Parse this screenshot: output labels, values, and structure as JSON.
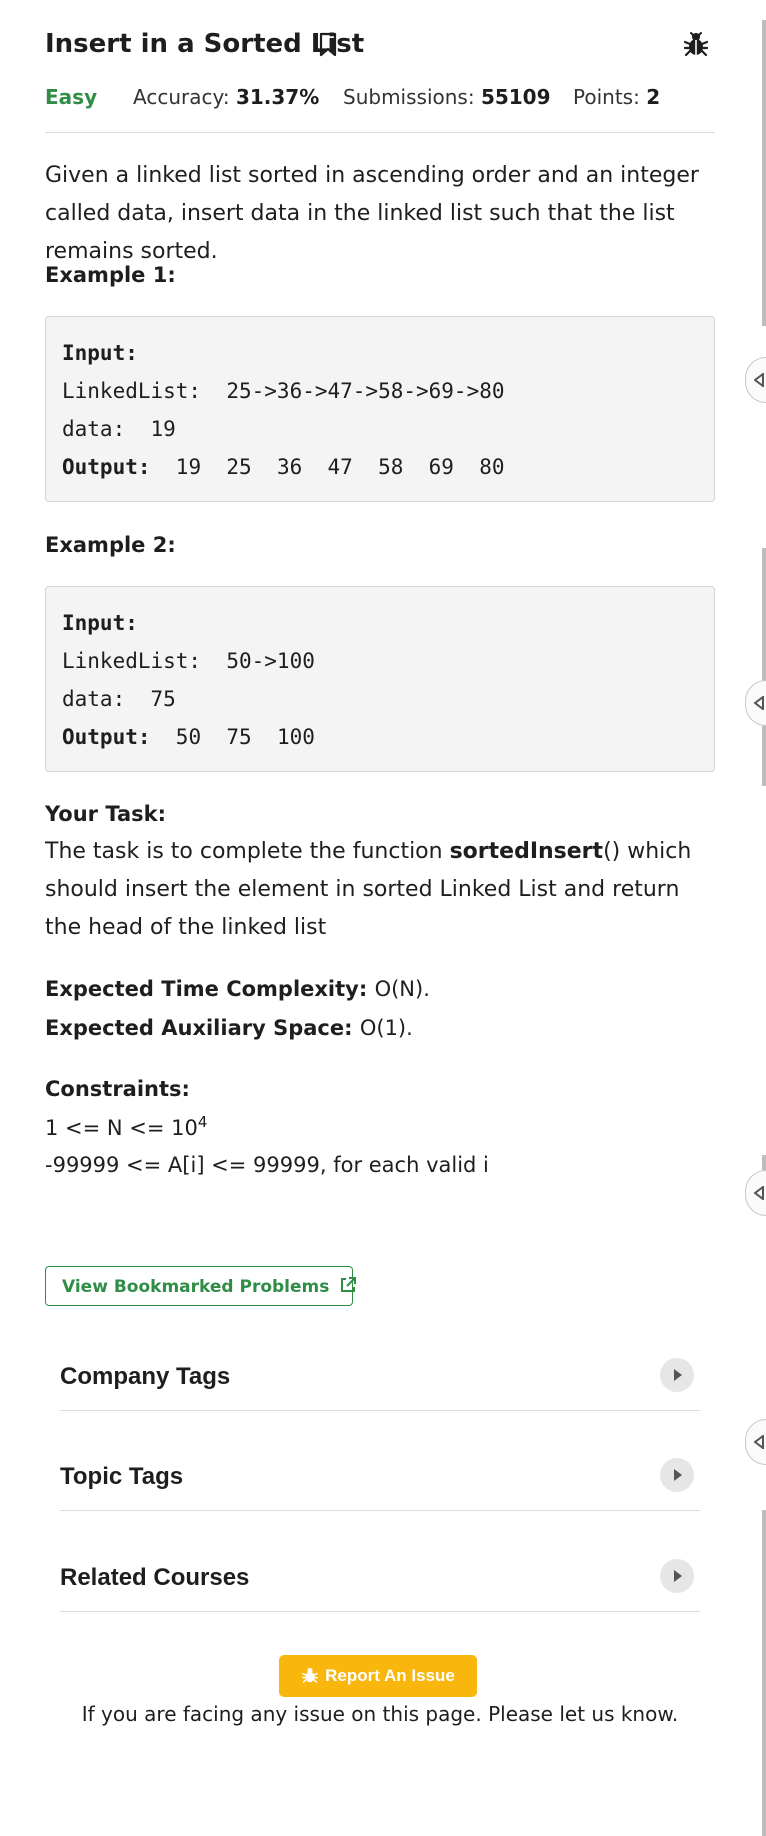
{
  "header": {
    "title": "Insert in a Sorted List",
    "difficulty": "Easy",
    "accuracy_label": "Accuracy: ",
    "accuracy_value": "31.37%",
    "submissions_label": "Submissions: ",
    "submissions_value": "55109",
    "points_label": "Points: ",
    "points_value": "2"
  },
  "description": "Given a linked list sorted in ascending order and an integer called data, insert data in the linked list such that the list remains sorted.",
  "examples": [
    {
      "heading": "Example 1:",
      "input_label": "Input:",
      "list_line": "LinkedList:  25->36->47->58->69->80",
      "data_line": "data:  19",
      "output_label": "Output:",
      "output_value": "  19  25  36  47  58  69  80"
    },
    {
      "heading": "Example 2:",
      "input_label": "Input:",
      "list_line": "LinkedList:  50->100",
      "data_line": "data:  75",
      "output_label": "Output:",
      "output_value": "  50  75  100"
    }
  ],
  "task": {
    "heading": "Your Task:",
    "text_before": "The task is to complete the function ",
    "function_name": "sortedInsert",
    "text_after": "() which should insert the element in sorted Linked List and return the head of the linked list"
  },
  "complexity": {
    "time_label": "Expected Time Complexity: ",
    "time_value": "O(N).",
    "space_label": "Expected Auxiliary Space: ",
    "space_value": "O(1)."
  },
  "constraints": {
    "heading": "Constraints:",
    "line1_prefix": "1 <= N <= 10",
    "line1_exp": "4",
    "line2": "-99999 <= A[i] <= 99999, for each valid i"
  },
  "view_bookmarked_label": "View Bookmarked Problems",
  "accordion": [
    {
      "label": "Company Tags"
    },
    {
      "label": "Topic Tags"
    },
    {
      "label": "Related Courses"
    }
  ],
  "report": {
    "button_label": "Report An Issue",
    "note": "If you are facing any issue on this page. Please let us know."
  },
  "colors": {
    "accent_green": "#2f8d46",
    "report_yellow": "#f9b70d",
    "example_bg": "#f4f4f4"
  },
  "icons": [
    "bookmark-icon",
    "bug-icon",
    "external-link-icon",
    "chevron-right-icon",
    "side-collapse-icon"
  ]
}
